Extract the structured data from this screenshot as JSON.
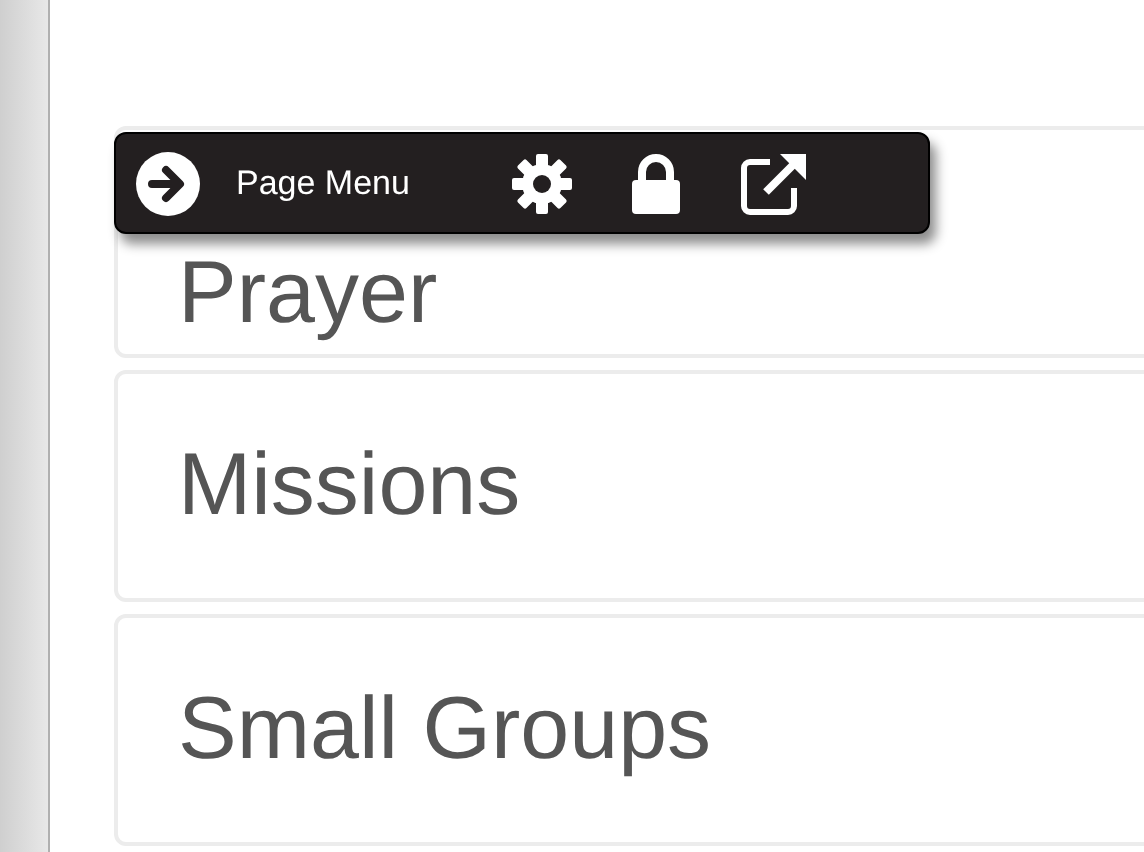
{
  "cards": [
    {
      "title": "Prayer"
    },
    {
      "title": "Missions"
    },
    {
      "title": "Small Groups"
    }
  ],
  "toolbar": {
    "label": "Page Menu"
  }
}
